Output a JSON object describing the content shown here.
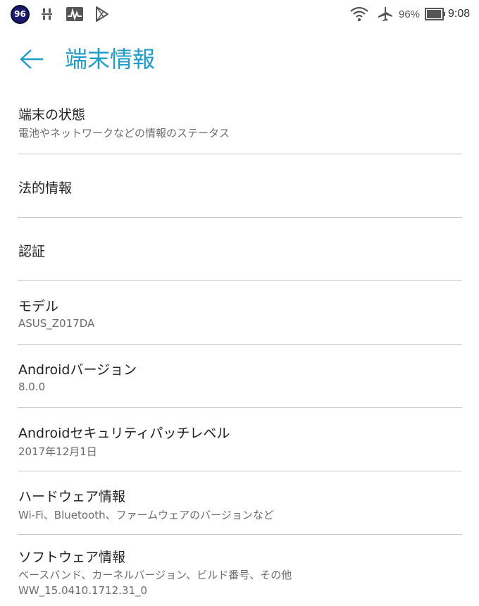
{
  "status_bar": {
    "badge": "96",
    "battery_percent_text": "96%",
    "battery_level": 0.96,
    "time": "9:08",
    "icons": [
      "badge-96-icon",
      "usb-debug-icon",
      "activity-monitor-icon",
      "play-store-icon",
      "wifi-icon",
      "airplane-icon",
      "battery-icon"
    ]
  },
  "app_bar": {
    "back_icon": "arrow-left-icon",
    "title": "端末情報"
  },
  "items": [
    {
      "title": "端末の状態",
      "subtitle": "電池やネットワークなどの情報のステータス"
    },
    {
      "title": "法的情報"
    },
    {
      "title": "認証"
    },
    {
      "title": "モデル",
      "subtitle": "ASUS_Z017DA"
    },
    {
      "title": "Androidバージョン",
      "subtitle": "8.0.0"
    },
    {
      "title": "Androidセキュリティパッチレベル",
      "subtitle": "2017年12月1日"
    },
    {
      "title": "ハードウェア情報",
      "subtitle": "Wi-Fi、Bluetooth、ファームウェアのバージョンなど"
    },
    {
      "title": "ソフトウェア情報",
      "subtitle": "ベースバンド、カーネルバージョン、ビルド番号、その他",
      "subtitle2": "WW_15.0410.1712.31_0"
    }
  ],
  "colors": {
    "accent": "#1e9bc8",
    "text_primary": "#212121",
    "text_secondary": "#6b6b6b",
    "divider": "#c8c8c8"
  }
}
